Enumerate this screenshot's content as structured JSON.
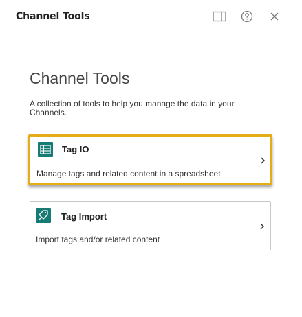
{
  "header": {
    "title": "Channel Tools",
    "buttons": [
      {
        "icon": "side-panel-icon"
      },
      {
        "icon": "help-icon"
      },
      {
        "icon": "close-icon"
      }
    ]
  },
  "main": {
    "title": "Channel Tools",
    "description": "A collection of tools to help you manage the data in your Channels.",
    "tools": [
      {
        "name": "Tag IO",
        "description": "Manage tags and related content in a spreadsheet",
        "icon": "spreadsheet-icon",
        "highlighted": true
      },
      {
        "name": "Tag Import",
        "description": "Import tags and/or related content",
        "icon": "tag-import-icon",
        "highlighted": false
      }
    ]
  },
  "colors": {
    "accent_teal": "#167b74",
    "highlight_border": "#e3ad18",
    "icon_gray": "#7a7a7a"
  }
}
